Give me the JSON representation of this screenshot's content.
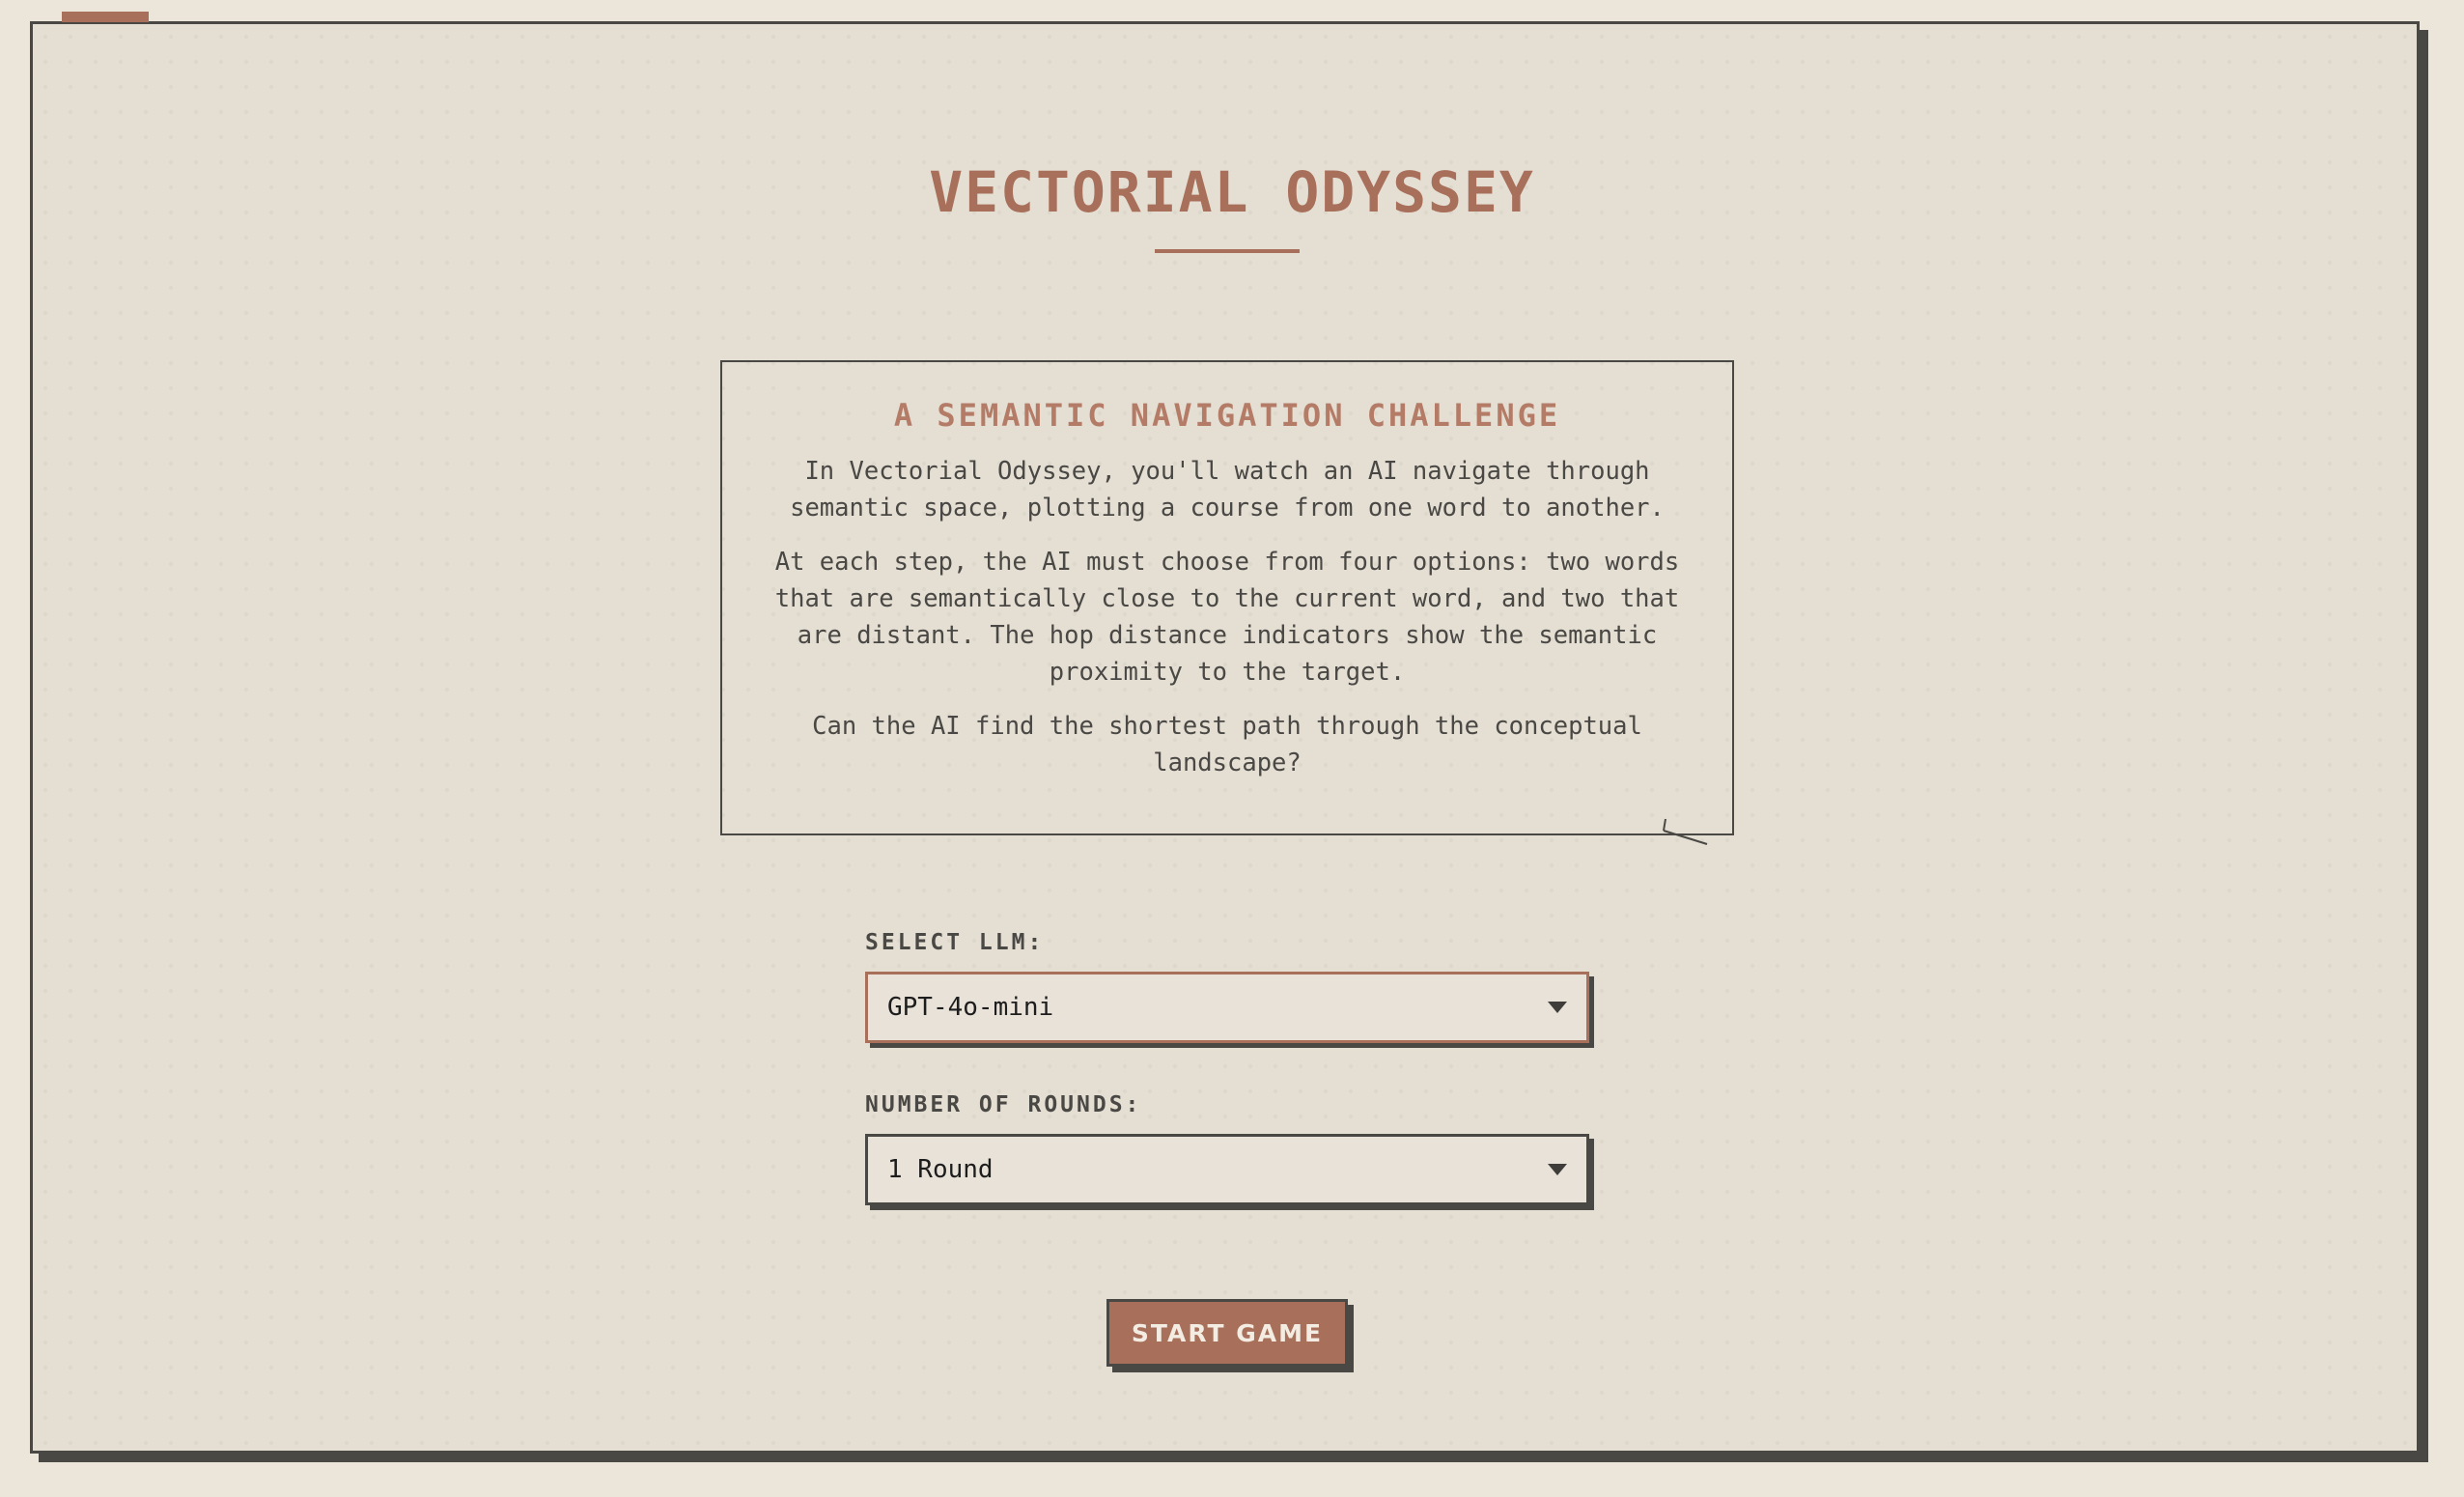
{
  "app": {
    "title": "VECTORIAL ODYSSEY"
  },
  "intro": {
    "heading": "A SEMANTIC NAVIGATION CHALLENGE",
    "paragraphs": [
      "In Vectorial Odyssey, you'll watch an AI navigate through semantic space, plotting a course from one word to another.",
      "At each step, the AI must choose from four options: two words that are semantically close to the current word, and two that are distant. The hop distance indicators show the semantic proximity to the target.",
      "Can the AI find the shortest path through the conceptual landscape?"
    ]
  },
  "settings": {
    "llm_label": "SELECT LLM:",
    "llm_selected": "GPT-4o-mini",
    "rounds_label": "NUMBER OF ROUNDS:",
    "rounds_selected": "1 Round"
  },
  "actions": {
    "start_label": "START GAME"
  },
  "colors": {
    "accent": "#a86f5a",
    "background": "#e4ded3",
    "border": "#4a4844"
  }
}
